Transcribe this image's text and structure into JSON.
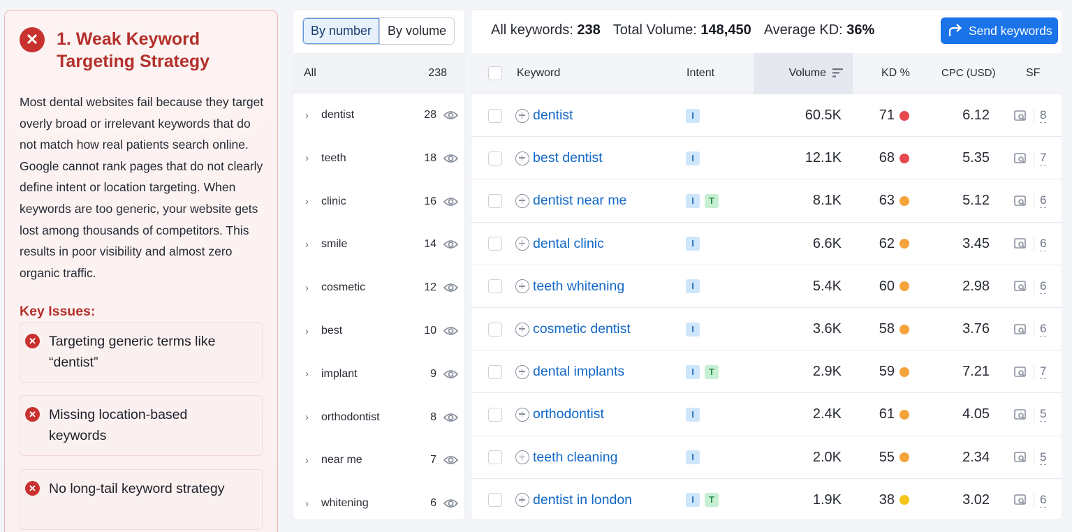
{
  "issue": {
    "title": "1. Weak Keyword Targeting Strategy",
    "body": "Most dental websites fail because they target overly broad or irrelevant keywords that do not match how real patients search online. Google cannot rank pages that do not clearly define intent or location targeting. When keywords are too generic, your website gets lost among thousands of competitors. This results in poor visibility and almost zero organic traffic.",
    "key_issues_label": "Key Issues:",
    "key_issues": [
      "Targeting generic terms like “dentist”",
      "Missing location-based keywords",
      "No long-tail keyword strategy"
    ],
    "accent_color": "#c8322e"
  },
  "groups": {
    "toggle": {
      "by_number": "By number",
      "by_volume": "By volume",
      "active": "by_number"
    },
    "all_label": "All",
    "all_count": "238",
    "items": [
      {
        "name": "dentist",
        "count": "28"
      },
      {
        "name": "teeth",
        "count": "18"
      },
      {
        "name": "clinic",
        "count": "16"
      },
      {
        "name": "smile",
        "count": "14"
      },
      {
        "name": "cosmetic",
        "count": "12"
      },
      {
        "name": "best",
        "count": "10"
      },
      {
        "name": "implant",
        "count": "9"
      },
      {
        "name": "orthodontist",
        "count": "8"
      },
      {
        "name": "near me",
        "count": "7"
      },
      {
        "name": "whitening",
        "count": "6"
      }
    ]
  },
  "summary": {
    "all_keywords_label": "All keywords:",
    "all_keywords_value": "238",
    "total_volume_label": "Total Volume:",
    "total_volume_value": "148,450",
    "avg_kd_label": "Average KD:",
    "avg_kd_value": "36%",
    "send_button": "Send keywords"
  },
  "table": {
    "headers": {
      "keyword": "Keyword",
      "intent": "Intent",
      "volume": "Volume",
      "kd": "KD %",
      "cpc": "CPC (USD)",
      "sf": "SF"
    },
    "rows": [
      {
        "keyword": "dentist",
        "intent": [
          "I"
        ],
        "volume": "60.5K",
        "kd": "71",
        "kd_color": "#e5484d",
        "cpc": "6.12",
        "sf": "8"
      },
      {
        "keyword": "best dentist",
        "intent": [
          "I"
        ],
        "volume": "12.1K",
        "kd": "68",
        "kd_color": "#e5484d",
        "cpc": "5.35",
        "sf": "7"
      },
      {
        "keyword": "dentist near me",
        "intent": [
          "I",
          "T"
        ],
        "volume": "8.1K",
        "kd": "63",
        "kd_color": "#f5a33b",
        "cpc": "5.12",
        "sf": "6"
      },
      {
        "keyword": "dental clinic",
        "intent": [
          "I"
        ],
        "volume": "6.6K",
        "kd": "62",
        "kd_color": "#f5a33b",
        "cpc": "3.45",
        "sf": "6"
      },
      {
        "keyword": "teeth whitening",
        "intent": [
          "I"
        ],
        "volume": "5.4K",
        "kd": "60",
        "kd_color": "#f5a33b",
        "cpc": "2.98",
        "sf": "6"
      },
      {
        "keyword": "cosmetic dentist",
        "intent": [
          "I"
        ],
        "volume": "3.6K",
        "kd": "58",
        "kd_color": "#f5a33b",
        "cpc": "3.76",
        "sf": "6"
      },
      {
        "keyword": "dental implants",
        "intent": [
          "I",
          "T"
        ],
        "volume": "2.9K",
        "kd": "59",
        "kd_color": "#f5a33b",
        "cpc": "7.21",
        "sf": "7"
      },
      {
        "keyword": "orthodontist",
        "intent": [
          "I"
        ],
        "volume": "2.4K",
        "kd": "61",
        "kd_color": "#f5a33b",
        "cpc": "4.05",
        "sf": "5"
      },
      {
        "keyword": "teeth cleaning",
        "intent": [
          "I"
        ],
        "volume": "2.0K",
        "kd": "55",
        "kd_color": "#f5a33b",
        "cpc": "2.34",
        "sf": "5"
      },
      {
        "keyword": "dentist in london",
        "intent": [
          "I",
          "T"
        ],
        "volume": "1.9K",
        "kd": "38",
        "kd_color": "#f5c518",
        "cpc": "3.02",
        "sf": "6"
      }
    ]
  }
}
